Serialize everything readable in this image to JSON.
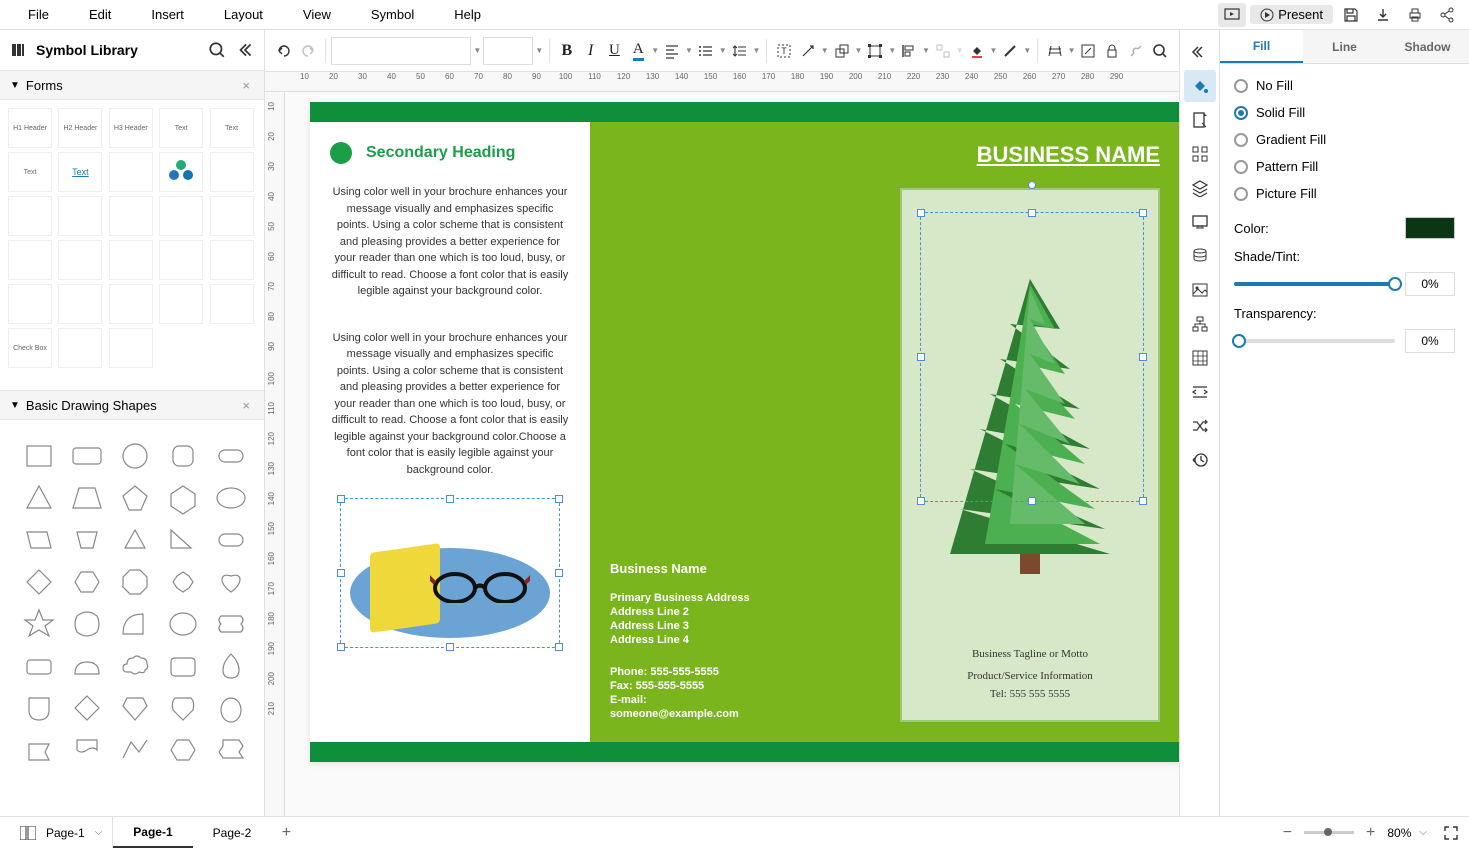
{
  "menu": {
    "items": [
      "File",
      "Edit",
      "Insert",
      "Layout",
      "View",
      "Symbol",
      "Help"
    ],
    "present": "Present"
  },
  "sidebar": {
    "title": "Symbol Library",
    "sections": {
      "forms": "Forms",
      "shapes": "Basic Drawing Shapes"
    },
    "form_thumbs": [
      "H1 Header",
      "H2 Header",
      "H3 Header",
      "Text",
      "Text",
      "Text",
      "Text",
      "",
      "",
      "",
      "",
      "",
      "",
      "",
      "",
      "",
      "",
      "",
      "",
      "",
      "",
      "",
      "",
      "",
      "",
      "Check Box",
      "",
      ""
    ]
  },
  "ruler_h": [
    "10",
    "20",
    "30",
    "40",
    "50",
    "60",
    "70",
    "80",
    "90",
    "100",
    "110",
    "120",
    "130",
    "140",
    "150",
    "160",
    "170",
    "180",
    "190",
    "200",
    "210",
    "220",
    "230",
    "240",
    "250",
    "260",
    "270",
    "280",
    "290"
  ],
  "ruler_v": [
    "10",
    "20",
    "30",
    "40",
    "50",
    "60",
    "70",
    "80",
    "90",
    "100",
    "110",
    "120",
    "130",
    "140",
    "150",
    "160",
    "170",
    "180",
    "190",
    "200",
    "210"
  ],
  "brochure": {
    "secondary_heading": "Secondary Heading",
    "para1": "Using color well in your brochure enhances your message visually and emphasizes specific points. Using a color scheme that is consistent and pleasing provides a better experience for your reader than one which is too loud, busy, or difficult to read. Choose a font color that is easily legible against your background color.",
    "para2": "Using color well in your brochure enhances your message visually and emphasizes specific points. Using a color scheme that is consistent and pleasing provides a better experience for your reader than one which is too loud, busy, or difficult to read. Choose a font color that is easily legible against your background color.Choose a font color that is easily legible against your background color.",
    "business_name_caps": "BUSINESS NAME",
    "business_name": "Business Name",
    "addr_primary": "Primary Business Address",
    "addr2": "Address Line 2",
    "addr3": "Address Line 3",
    "addr4": "Address Line 4",
    "phone": "Phone: 555-555-5555",
    "fax": "Fax: 555-555-5555",
    "email_label": "E-mail:",
    "email": "someone@example.com",
    "tagline1": "Business Tagline or Motto",
    "tagline2": "Product/Service Information",
    "tagline3": "Tel: 555 555 5555"
  },
  "right_panel": {
    "tabs": [
      "Fill",
      "Line",
      "Shadow"
    ],
    "fill_options": [
      "No Fill",
      "Solid Fill",
      "Gradient Fill",
      "Pattern Fill",
      "Picture Fill"
    ],
    "color_label": "Color:",
    "shade_label": "Shade/Tint:",
    "shade_value": "0%",
    "transparency_label": "Transparency:",
    "transparency_value": "0%"
  },
  "bottom": {
    "page_current": "Page-1",
    "tabs": [
      "Page-1",
      "Page-2"
    ],
    "zoom": "80%"
  }
}
